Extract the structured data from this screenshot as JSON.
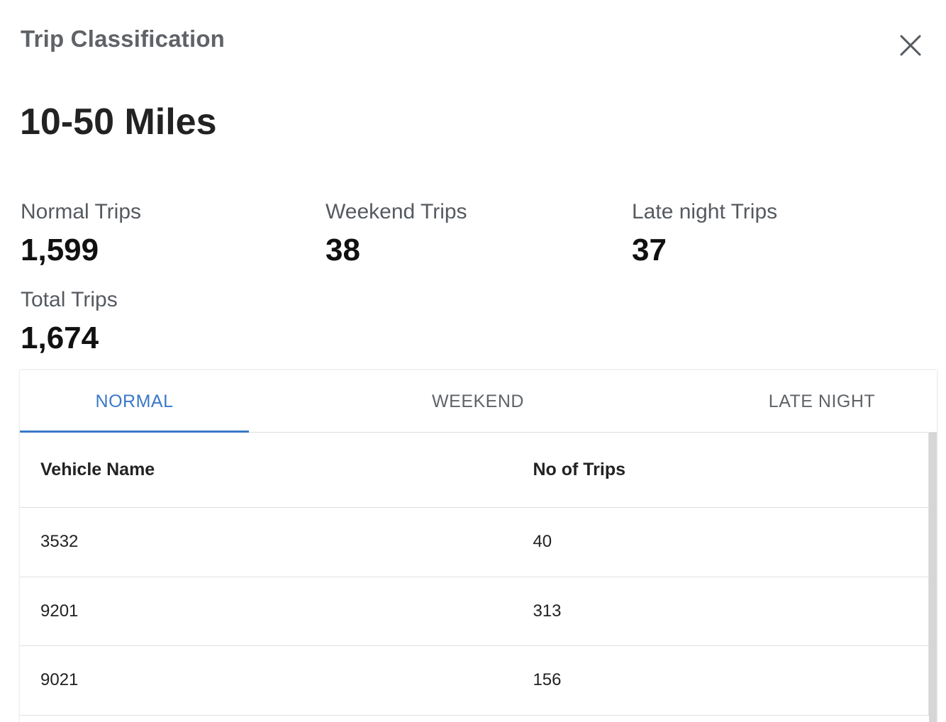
{
  "header": {
    "title": "Trip Classification"
  },
  "range": {
    "title": "10-50 Miles"
  },
  "stats": {
    "normal": {
      "label": "Normal Trips",
      "value": "1,599"
    },
    "weekend": {
      "label": "Weekend Trips",
      "value": "38"
    },
    "late": {
      "label": "Late night Trips",
      "value": "37"
    },
    "total": {
      "label": "Total Trips",
      "value": "1,674"
    }
  },
  "tabs": [
    {
      "label": "NORMAL",
      "active": true
    },
    {
      "label": "WEEKEND",
      "active": false
    },
    {
      "label": "LATE NIGHT",
      "active": false
    }
  ],
  "table": {
    "columns": [
      "Vehicle Name",
      "No of Trips"
    ],
    "rows": [
      [
        "3532",
        "40"
      ],
      [
        "9201",
        "313"
      ],
      [
        "9021",
        "156"
      ]
    ]
  },
  "colors": {
    "accent": "#3a78c9",
    "title_gray": "#5f6368"
  },
  "icons": {
    "close": "close-icon"
  }
}
